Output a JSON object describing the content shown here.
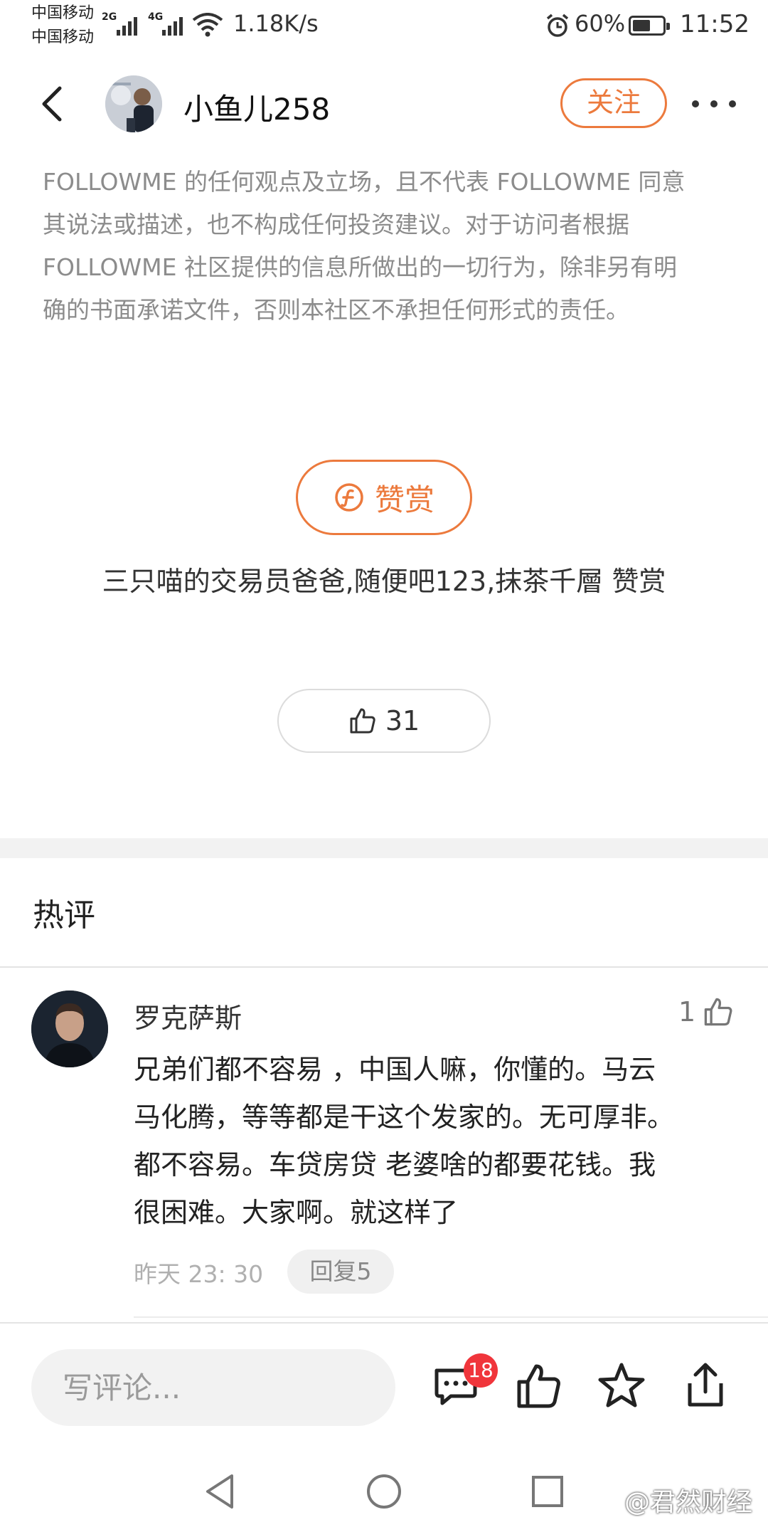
{
  "status_bar": {
    "carrier_1": "中国移动",
    "carrier_2": "中国移动",
    "network_1": "2G",
    "network_2": "4G",
    "net_speed": "1.18K/s",
    "battery_percent": "60%",
    "battery_level": 0.6,
    "time": "11:52"
  },
  "header": {
    "author_name": "小鱼儿258",
    "follow_label": "关注"
  },
  "disclaimer": {
    "lines": [
      "FOLLOWME 的任何观点及立场，且不代表 FOLLOWME 同意",
      "其说法或描述，也不构成任何投资建议。对于访问者根据",
      "FOLLOWME 社区提供的信息所做出的一切行为，除非另有明",
      "确的书面承诺文件，否则本社区不承担任何形式的责任。"
    ]
  },
  "tip": {
    "label": "赞赏",
    "users": "三只喵的交易员爸爸,随便吧123,抹茶千層 赞赏"
  },
  "like": {
    "count": "31"
  },
  "hot_comments": {
    "title": "热评",
    "items": [
      {
        "user": "罗克萨斯",
        "likes": "1",
        "lines": [
          "兄弟们都不容易 ，中国人嘛，你懂的。马云",
          "马化腾，等等都是干这个发家的。无可厚非。",
          "都不容易。车贷房贷 老婆啥的都要花钱。我",
          "很困难。大家啊。就这样了"
        ],
        "time": "昨天 23: 30",
        "reply_label": "回复5"
      }
    ]
  },
  "bottom_bar": {
    "comment_placeholder": "写评论...",
    "comment_badge": "18"
  },
  "watermark": "@君然财经",
  "colors": {
    "accent": "#ec7a3d",
    "badge": "#f0353b",
    "muted_text": "#8c8c8c"
  },
  "icons": [
    "back-arrow-icon",
    "more-dots-icon",
    "coin-icon",
    "thumbs-up-icon",
    "comment-icon",
    "star-icon",
    "share-icon",
    "nav-back-icon",
    "nav-home-icon",
    "nav-recent-icon"
  ]
}
